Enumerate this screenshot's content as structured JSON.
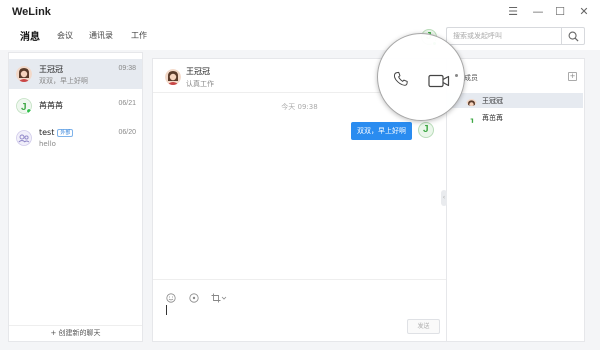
{
  "app": {
    "title": "WeLink"
  },
  "window_controls": {
    "menu": "☰",
    "minimize": "—",
    "maximize": "☐",
    "close": "✕"
  },
  "nav": {
    "tabs": [
      {
        "label": "消息",
        "active": true
      },
      {
        "label": "会议",
        "active": false
      },
      {
        "label": "通讯录",
        "active": false
      },
      {
        "label": "工作",
        "active": false
      }
    ]
  },
  "search": {
    "placeholder": "搜索或发起呼叫"
  },
  "conversations": [
    {
      "name": "王冠冠",
      "preview": "双双，早上好啊",
      "time": "09:38",
      "selected": true
    },
    {
      "name": "苒苒苒",
      "preview": "",
      "time": "06/21",
      "selected": false
    },
    {
      "name": "test",
      "badge": "外部",
      "preview": "hello",
      "time": "06/20",
      "selected": false
    }
  ],
  "new_chat": {
    "label": "+ 创建新的聊天"
  },
  "chat": {
    "title": "王冠冠",
    "subtitle": "认真工作",
    "timestamp": "今天 09:38",
    "messages": [
      {
        "text": "双双，早上好啊",
        "from_self": true
      }
    ],
    "send_label": "发送"
  },
  "members": {
    "title": "成员",
    "add_label": "+",
    "list": [
      {
        "name": "王冠冠",
        "highlighted": true
      },
      {
        "name": "苒茁苒",
        "highlighted": false
      }
    ]
  },
  "colors": {
    "accent": "#2a8cf0",
    "online": "#2fbf4a",
    "selected_bg": "#e6eaf0"
  },
  "icons": {
    "call": "phone-icon",
    "video": "video-icon",
    "search": "search-icon",
    "emoji": "emoji-icon",
    "screenshot": "screenshot-icon",
    "crop": "crop-icon"
  }
}
